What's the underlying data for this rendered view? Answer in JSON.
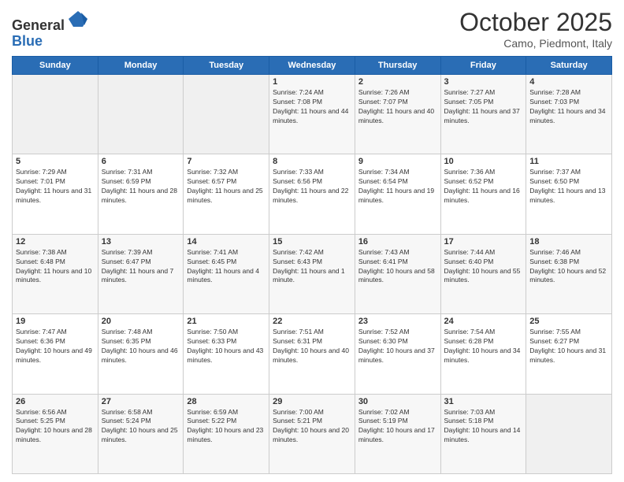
{
  "header": {
    "logo_line1": "General",
    "logo_line2": "Blue",
    "month": "October 2025",
    "location": "Camo, Piedmont, Italy"
  },
  "weekdays": [
    "Sunday",
    "Monday",
    "Tuesday",
    "Wednesday",
    "Thursday",
    "Friday",
    "Saturday"
  ],
  "weeks": [
    [
      {
        "day": "",
        "sunrise": "",
        "sunset": "",
        "daylight": ""
      },
      {
        "day": "",
        "sunrise": "",
        "sunset": "",
        "daylight": ""
      },
      {
        "day": "",
        "sunrise": "",
        "sunset": "",
        "daylight": ""
      },
      {
        "day": "1",
        "sunrise": "Sunrise: 7:24 AM",
        "sunset": "Sunset: 7:08 PM",
        "daylight": "Daylight: 11 hours and 44 minutes."
      },
      {
        "day": "2",
        "sunrise": "Sunrise: 7:26 AM",
        "sunset": "Sunset: 7:07 PM",
        "daylight": "Daylight: 11 hours and 40 minutes."
      },
      {
        "day": "3",
        "sunrise": "Sunrise: 7:27 AM",
        "sunset": "Sunset: 7:05 PM",
        "daylight": "Daylight: 11 hours and 37 minutes."
      },
      {
        "day": "4",
        "sunrise": "Sunrise: 7:28 AM",
        "sunset": "Sunset: 7:03 PM",
        "daylight": "Daylight: 11 hours and 34 minutes."
      }
    ],
    [
      {
        "day": "5",
        "sunrise": "Sunrise: 7:29 AM",
        "sunset": "Sunset: 7:01 PM",
        "daylight": "Daylight: 11 hours and 31 minutes."
      },
      {
        "day": "6",
        "sunrise": "Sunrise: 7:31 AM",
        "sunset": "Sunset: 6:59 PM",
        "daylight": "Daylight: 11 hours and 28 minutes."
      },
      {
        "day": "7",
        "sunrise": "Sunrise: 7:32 AM",
        "sunset": "Sunset: 6:57 PM",
        "daylight": "Daylight: 11 hours and 25 minutes."
      },
      {
        "day": "8",
        "sunrise": "Sunrise: 7:33 AM",
        "sunset": "Sunset: 6:56 PM",
        "daylight": "Daylight: 11 hours and 22 minutes."
      },
      {
        "day": "9",
        "sunrise": "Sunrise: 7:34 AM",
        "sunset": "Sunset: 6:54 PM",
        "daylight": "Daylight: 11 hours and 19 minutes."
      },
      {
        "day": "10",
        "sunrise": "Sunrise: 7:36 AM",
        "sunset": "Sunset: 6:52 PM",
        "daylight": "Daylight: 11 hours and 16 minutes."
      },
      {
        "day": "11",
        "sunrise": "Sunrise: 7:37 AM",
        "sunset": "Sunset: 6:50 PM",
        "daylight": "Daylight: 11 hours and 13 minutes."
      }
    ],
    [
      {
        "day": "12",
        "sunrise": "Sunrise: 7:38 AM",
        "sunset": "Sunset: 6:48 PM",
        "daylight": "Daylight: 11 hours and 10 minutes."
      },
      {
        "day": "13",
        "sunrise": "Sunrise: 7:39 AM",
        "sunset": "Sunset: 6:47 PM",
        "daylight": "Daylight: 11 hours and 7 minutes."
      },
      {
        "day": "14",
        "sunrise": "Sunrise: 7:41 AM",
        "sunset": "Sunset: 6:45 PM",
        "daylight": "Daylight: 11 hours and 4 minutes."
      },
      {
        "day": "15",
        "sunrise": "Sunrise: 7:42 AM",
        "sunset": "Sunset: 6:43 PM",
        "daylight": "Daylight: 11 hours and 1 minute."
      },
      {
        "day": "16",
        "sunrise": "Sunrise: 7:43 AM",
        "sunset": "Sunset: 6:41 PM",
        "daylight": "Daylight: 10 hours and 58 minutes."
      },
      {
        "day": "17",
        "sunrise": "Sunrise: 7:44 AM",
        "sunset": "Sunset: 6:40 PM",
        "daylight": "Daylight: 10 hours and 55 minutes."
      },
      {
        "day": "18",
        "sunrise": "Sunrise: 7:46 AM",
        "sunset": "Sunset: 6:38 PM",
        "daylight": "Daylight: 10 hours and 52 minutes."
      }
    ],
    [
      {
        "day": "19",
        "sunrise": "Sunrise: 7:47 AM",
        "sunset": "Sunset: 6:36 PM",
        "daylight": "Daylight: 10 hours and 49 minutes."
      },
      {
        "day": "20",
        "sunrise": "Sunrise: 7:48 AM",
        "sunset": "Sunset: 6:35 PM",
        "daylight": "Daylight: 10 hours and 46 minutes."
      },
      {
        "day": "21",
        "sunrise": "Sunrise: 7:50 AM",
        "sunset": "Sunset: 6:33 PM",
        "daylight": "Daylight: 10 hours and 43 minutes."
      },
      {
        "day": "22",
        "sunrise": "Sunrise: 7:51 AM",
        "sunset": "Sunset: 6:31 PM",
        "daylight": "Daylight: 10 hours and 40 minutes."
      },
      {
        "day": "23",
        "sunrise": "Sunrise: 7:52 AM",
        "sunset": "Sunset: 6:30 PM",
        "daylight": "Daylight: 10 hours and 37 minutes."
      },
      {
        "day": "24",
        "sunrise": "Sunrise: 7:54 AM",
        "sunset": "Sunset: 6:28 PM",
        "daylight": "Daylight: 10 hours and 34 minutes."
      },
      {
        "day": "25",
        "sunrise": "Sunrise: 7:55 AM",
        "sunset": "Sunset: 6:27 PM",
        "daylight": "Daylight: 10 hours and 31 minutes."
      }
    ],
    [
      {
        "day": "26",
        "sunrise": "Sunrise: 6:56 AM",
        "sunset": "Sunset: 5:25 PM",
        "daylight": "Daylight: 10 hours and 28 minutes."
      },
      {
        "day": "27",
        "sunrise": "Sunrise: 6:58 AM",
        "sunset": "Sunset: 5:24 PM",
        "daylight": "Daylight: 10 hours and 25 minutes."
      },
      {
        "day": "28",
        "sunrise": "Sunrise: 6:59 AM",
        "sunset": "Sunset: 5:22 PM",
        "daylight": "Daylight: 10 hours and 23 minutes."
      },
      {
        "day": "29",
        "sunrise": "Sunrise: 7:00 AM",
        "sunset": "Sunset: 5:21 PM",
        "daylight": "Daylight: 10 hours and 20 minutes."
      },
      {
        "day": "30",
        "sunrise": "Sunrise: 7:02 AM",
        "sunset": "Sunset: 5:19 PM",
        "daylight": "Daylight: 10 hours and 17 minutes."
      },
      {
        "day": "31",
        "sunrise": "Sunrise: 7:03 AM",
        "sunset": "Sunset: 5:18 PM",
        "daylight": "Daylight: 10 hours and 14 minutes."
      },
      {
        "day": "",
        "sunrise": "",
        "sunset": "",
        "daylight": ""
      }
    ]
  ]
}
